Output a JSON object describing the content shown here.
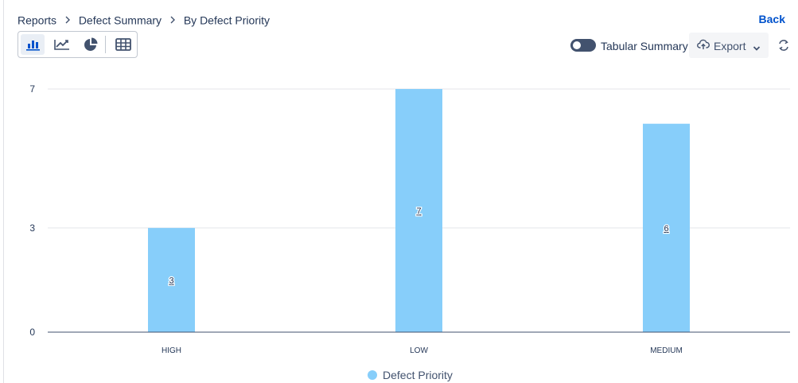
{
  "breadcrumb": {
    "items": [
      "Reports",
      "Defect Summary"
    ],
    "current": "By Defect Priority"
  },
  "back_label": "Back",
  "chart_switcher": {
    "options": [
      "bar-chart-icon",
      "line-chart-icon",
      "pie-chart-icon",
      "table-icon"
    ],
    "active": "bar-chart-icon"
  },
  "tabular_summary": {
    "label": "Tabular Summary",
    "enabled": false
  },
  "export": {
    "label": "Export"
  },
  "colors": {
    "bar": "#87cefa",
    "accent": "#0052cc",
    "toggle": "#42526e"
  },
  "chart_data": {
    "type": "bar",
    "categories": [
      "HIGH",
      "LOW",
      "MEDIUM"
    ],
    "series": [
      {
        "name": "Defect Priority",
        "values": [
          3,
          7,
          6
        ]
      }
    ],
    "data_labels": [
      "3",
      "7",
      "6"
    ],
    "ylim": [
      0,
      7
    ],
    "yticks": [
      "0",
      "3",
      "7"
    ],
    "grid": true,
    "legend": "bottom"
  }
}
